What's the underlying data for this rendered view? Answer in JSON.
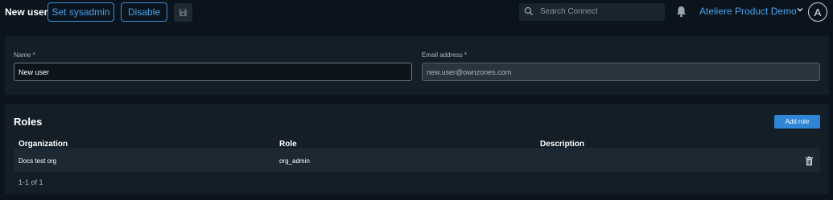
{
  "header": {
    "title": "New user",
    "set_sysadmin_label": "Set sysadmin",
    "disable_label": "Disable",
    "search_placeholder": "Search Connect",
    "org_name": "Ateliere Product Demo",
    "avatar_initial": "A"
  },
  "user_form": {
    "name_label": "Name *",
    "name_value": "New user",
    "email_label": "Email address *",
    "email_placeholder": "new.user@ownzones.com"
  },
  "roles": {
    "title": "Roles",
    "add_role_label": "Add role",
    "columns": [
      "Organization",
      "Role",
      "Description"
    ],
    "rows": [
      {
        "organization": "Docs test org",
        "role": "org_admin",
        "description": ""
      }
    ],
    "pagination": "1-1 of 1"
  },
  "colors": {
    "accent": "#3a8fd9",
    "background": "#0b141c",
    "panel": "#131e27",
    "primary_button": "#2f86d6"
  }
}
